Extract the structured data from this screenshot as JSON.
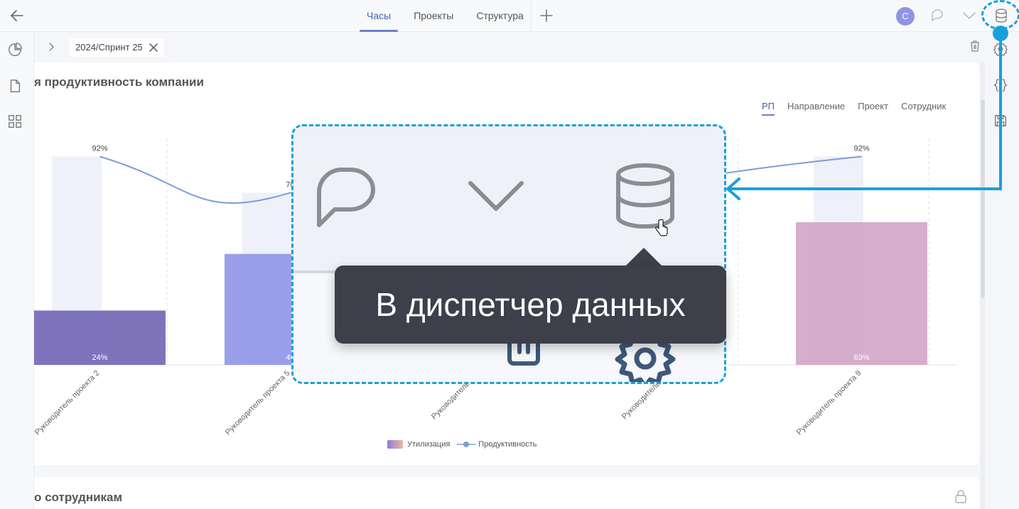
{
  "topbar": {
    "tabs": [
      {
        "label": "Часы",
        "active": true
      },
      {
        "label": "Проекты",
        "active": false
      },
      {
        "label": "Структура",
        "active": false
      }
    ],
    "avatar_initial": "С"
  },
  "breadcrumb": {
    "chip_label": "2024/Спринт 25"
  },
  "card": {
    "title": "я продуктивность компании",
    "filters": [
      {
        "label": "РП",
        "active": true
      },
      {
        "label": "Направление",
        "active": false
      },
      {
        "label": "Проект",
        "active": false
      },
      {
        "label": "Сотрудник",
        "active": false
      }
    ],
    "legend": {
      "utilization": "Утилизация",
      "productivity": "Продуктивность"
    }
  },
  "card2": {
    "title": "о сотрудникам"
  },
  "chart_data": {
    "type": "bar",
    "categories": [
      "Руководитель проекта 2",
      "Руководитель проекта 5",
      "Руководитель про",
      "Руководитель про",
      "Руководитель проекта 9"
    ],
    "series": [
      {
        "name": "Утилизация",
        "type": "bar",
        "values": [
          24,
          49,
          null,
          null,
          63
        ],
        "labels": [
          "24%",
          "49",
          "",
          "",
          "63%"
        ]
      },
      {
        "name": "Продуктивность",
        "type": "line",
        "values": [
          92,
          76,
          null,
          null,
          92
        ],
        "labels": [
          "92%",
          "76",
          "",
          "",
          "92%"
        ]
      }
    ],
    "ylim": [
      0,
      100
    ],
    "grid": true,
    "legend": "bottom-center"
  },
  "tooltip": {
    "text": "В диспетчер данных"
  },
  "colors": {
    "accent": "#6f7fd0",
    "callout": "#18a0dc",
    "bar_colors": [
      "#7468b6",
      "#9397e8",
      "#c39ad9",
      "#c98bb8",
      "#d2a7c7"
    ],
    "line": "#7b9ed6",
    "tooltip_bg": "#3d3f4b"
  }
}
